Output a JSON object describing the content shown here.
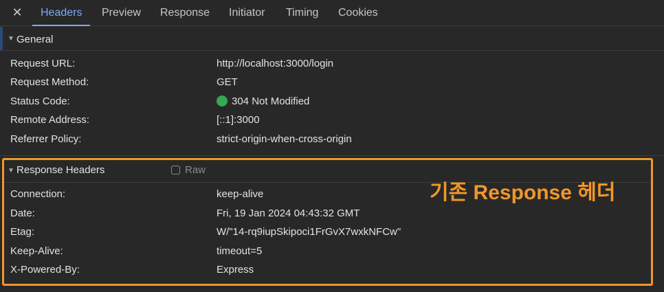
{
  "tabs": [
    {
      "label": "Headers",
      "active": true
    },
    {
      "label": "Preview",
      "active": false
    },
    {
      "label": "Response",
      "active": false
    },
    {
      "label": "Initiator",
      "active": false
    },
    {
      "label": "Timing",
      "active": false
    },
    {
      "label": "Cookies",
      "active": false
    }
  ],
  "close_icon": "✕",
  "general": {
    "title": "General",
    "rows": [
      {
        "label": "Request URL:",
        "value": "http://localhost:3000/login"
      },
      {
        "label": "Request Method:",
        "value": "GET"
      },
      {
        "label": "Status Code:",
        "value": "304 Not Modified"
      },
      {
        "label": "Remote Address:",
        "value": "[::1]:3000"
      },
      {
        "label": "Referrer Policy:",
        "value": "strict-origin-when-cross-origin"
      }
    ]
  },
  "response_headers": {
    "title": "Response Headers",
    "raw_label": "Raw",
    "raw_checked": false,
    "rows": [
      {
        "label": "Connection:",
        "value": "keep-alive"
      },
      {
        "label": "Date:",
        "value": "Fri, 19 Jan 2024 04:43:32 GMT"
      },
      {
        "label": "Etag:",
        "value": "W/\"14-rq9iupSkipoci1FrGvX7wxkNFCw\""
      },
      {
        "label": "Keep-Alive:",
        "value": "timeout=5"
      },
      {
        "label": "X-Powered-By:",
        "value": "Express"
      }
    ]
  },
  "annotation": {
    "text": "기존 Response 헤더",
    "color": "#f0972a"
  },
  "colors": {
    "status_ok": "#34a853",
    "active_tab": "#7cacf8"
  }
}
